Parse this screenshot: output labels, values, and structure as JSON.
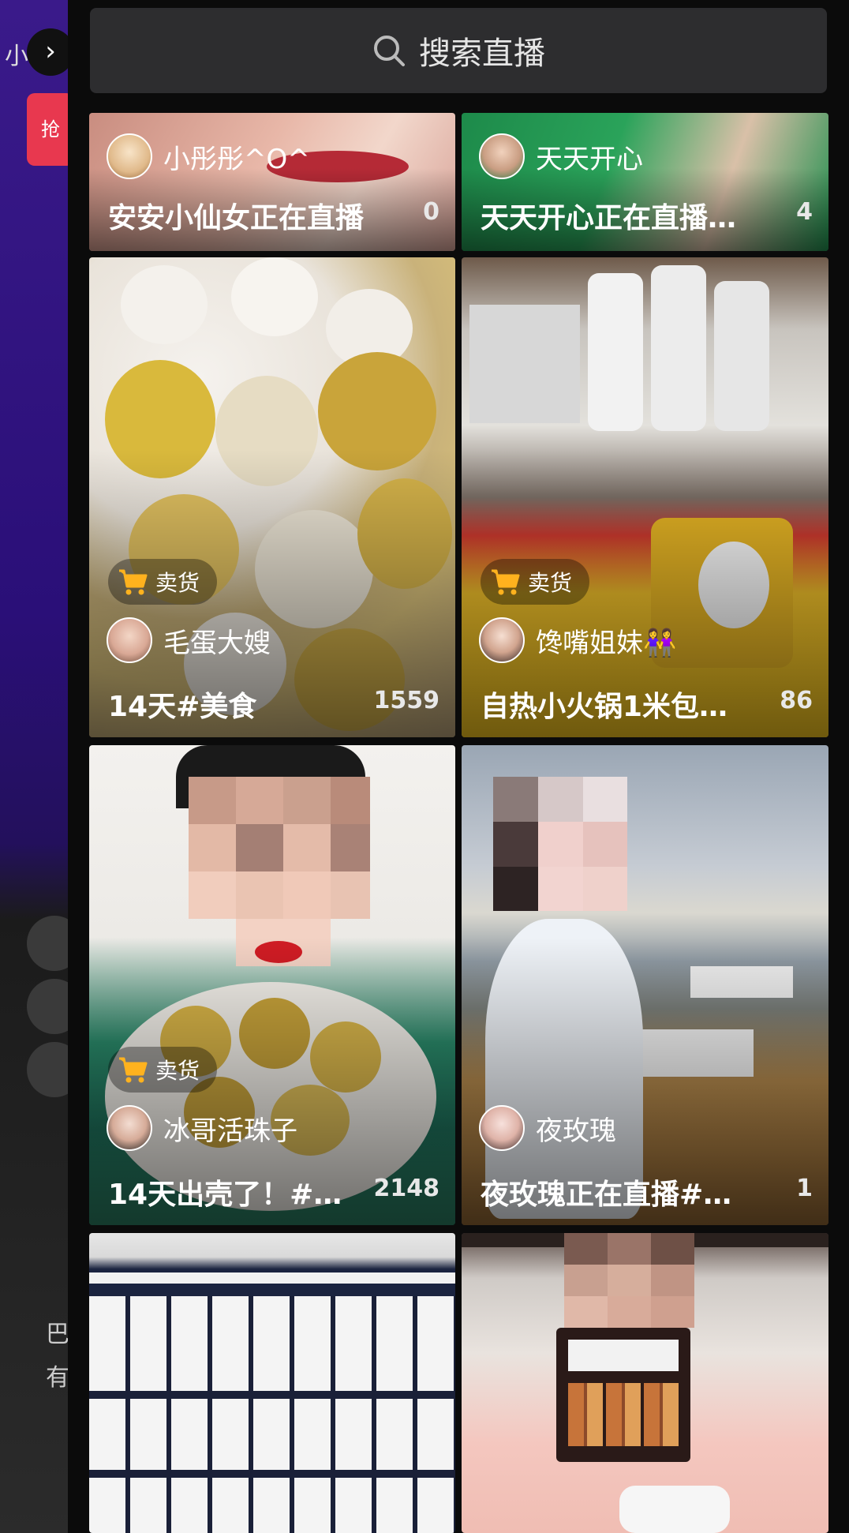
{
  "search": {
    "placeholder": "搜索直播",
    "icon": "search-icon"
  },
  "background_app": {
    "label": "小",
    "button": "抢",
    "lines": [
      "巴",
      "有"
    ]
  },
  "cards": [
    {
      "user": "小彤彤^O^",
      "title": "安安小仙女正在直播",
      "count": "0",
      "badge": ""
    },
    {
      "user": "天天开心",
      "title": "天天开心正在直播…",
      "count": "4",
      "badge": ""
    },
    {
      "user": "毛蛋大嫂",
      "title": "14天#美食",
      "count": "1559",
      "badge": "卖货"
    },
    {
      "user": "馋嘴姐妹👭",
      "title": "自热小火锅1米包…",
      "count": "86",
      "badge": "卖货"
    },
    {
      "user": "冰哥活珠子",
      "title": "14天出壳了！#…",
      "count": "2148",
      "badge": "卖货"
    },
    {
      "user": "夜玫瑰",
      "title": "夜玫瑰正在直播#…",
      "count": "1",
      "badge": ""
    }
  ],
  "colors": {
    "accent": "#ffb21e",
    "panel": "#0b0b0b",
    "search_bg": "#2d2d2f"
  }
}
